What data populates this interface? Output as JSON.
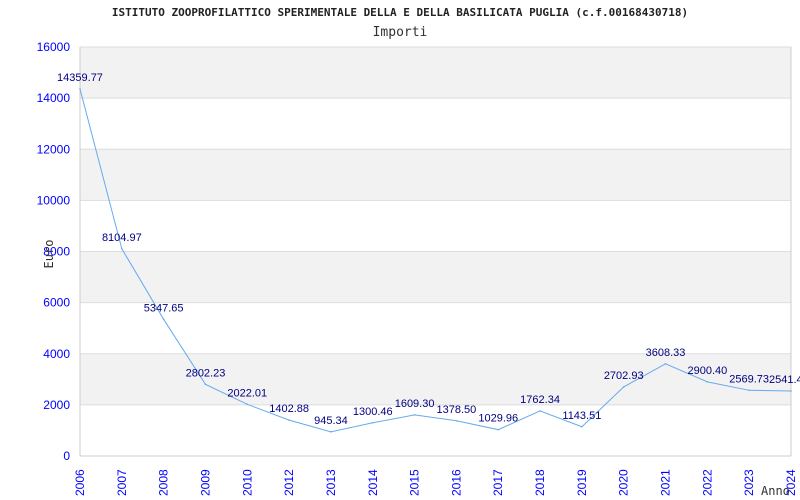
{
  "chart_data": {
    "type": "line",
    "title": "ISTITUTO ZOOPROFILATTICO SPERIMENTALE DELLA E DELLA BASILICATA PUGLIA (c.f.00168430718)",
    "subtitle": "Importi",
    "xlabel": "Anno",
    "ylabel": "Euro",
    "ylim": [
      0,
      16000
    ],
    "yticks": [
      "0",
      "2000",
      "4000",
      "6000",
      "8000",
      "10000",
      "12000",
      "14000",
      "16000"
    ],
    "grid": true,
    "categories": [
      "2006",
      "2007",
      "2008",
      "2009",
      "2010",
      "2012",
      "2013",
      "2014",
      "2015",
      "2016",
      "2017",
      "2018",
      "2019",
      "2020",
      "2021",
      "2022",
      "2023",
      "2024"
    ],
    "values": [
      14359.77,
      8104.97,
      5347.65,
      2802.23,
      2022.01,
      1402.88,
      945.34,
      1300.46,
      1609.3,
      1378.5,
      1029.96,
      1762.34,
      1143.51,
      2702.93,
      3608.33,
      2900.4,
      2569.73,
      2541.4
    ],
    "labels": [
      "14359.77",
      "8104.97",
      "5347.65",
      "2802.23",
      "2022.01",
      "1402.88",
      "945.34",
      "1300.46",
      "1609.30",
      "1378.50",
      "1029.96",
      "1762.34",
      "1143.51",
      "2702.93",
      "3608.33",
      "2900.40",
      "2569.73",
      "2541.4"
    ],
    "colors": {
      "line": "#66aaee",
      "band": "#f2f2f2",
      "tick": "#0000ff",
      "label": "#000080"
    }
  }
}
